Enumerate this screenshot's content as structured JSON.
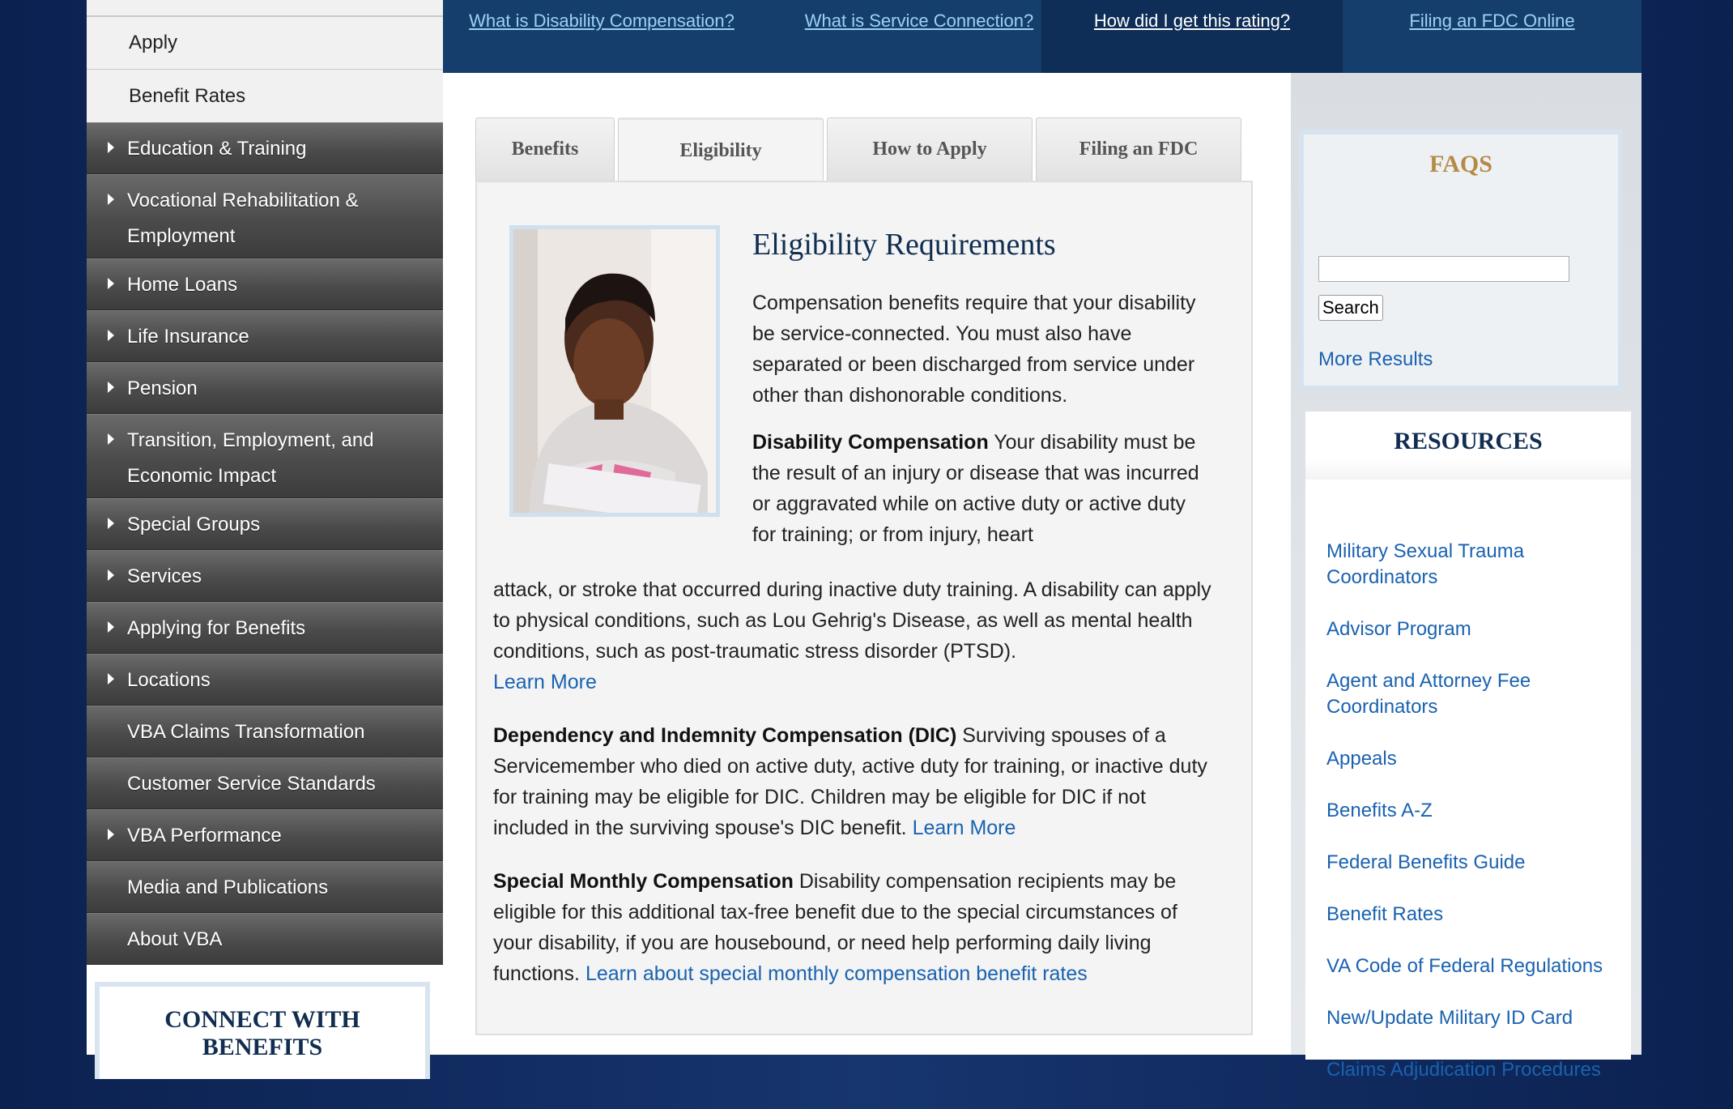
{
  "sidebar": {
    "light_items": [
      "Apply",
      "Benefit Rates"
    ],
    "dark_items": [
      {
        "label": "Education & Training",
        "arrow": true
      },
      {
        "label": "Vocational Rehabilitation & Employment",
        "arrow": true
      },
      {
        "label": "Home Loans",
        "arrow": true
      },
      {
        "label": "Life Insurance",
        "arrow": true
      },
      {
        "label": "Pension",
        "arrow": true
      },
      {
        "label": "Transition, Employment, and Economic Impact",
        "arrow": true
      },
      {
        "label": "Special Groups",
        "arrow": true
      },
      {
        "label": "Services",
        "arrow": true
      },
      {
        "label": "Applying for Benefits",
        "arrow": true
      },
      {
        "label": "Locations",
        "arrow": true
      },
      {
        "label": "VBA Claims Transformation",
        "arrow": false
      },
      {
        "label": "Customer Service Standards",
        "arrow": false
      },
      {
        "label": "VBA Performance",
        "arrow": true
      },
      {
        "label": "Media and Publications",
        "arrow": false
      },
      {
        "label": "About VBA",
        "arrow": false
      }
    ],
    "connect_title": "CONNECT WITH BENEFITS"
  },
  "topnav": {
    "links": [
      {
        "label": "What is Disability Compensation?",
        "active": false
      },
      {
        "label": "What is Service Connection?",
        "active": false
      },
      {
        "label": "How did I get this rating?",
        "active": true
      },
      {
        "label": "Filing an FDC Online",
        "active": false
      }
    ]
  },
  "tabs": [
    {
      "label": "Benefits",
      "active": false
    },
    {
      "label": "Eligibility",
      "active": true
    },
    {
      "label": "How to Apply",
      "active": false
    },
    {
      "label": "Filing an FDC",
      "active": false
    }
  ],
  "content": {
    "title": "Eligibility Requirements",
    "intro": "Compensation benefits require that your disability be service-connected. You must also have separated or been discharged from service under other than dishonorable conditions.",
    "disability": {
      "heading": "Disability Compensation",
      "text_top": " Your disability must be the result of an injury or disease that was incurred or aggravated while on active duty or active duty for training; or from injury, heart",
      "text_bottom": "attack, or stroke that occurred during inactive duty training. A disability can apply to physical conditions, such as Lou Gehrig's Disease, as well as mental health conditions, such as post-traumatic stress disorder (PTSD).",
      "link": "Learn More"
    },
    "dic": {
      "heading": "Dependency and Indemnity Compensation (DIC)",
      "text": " Surviving spouses of a Servicemember who died on active duty, active duty for training, or inactive duty for training may be eligible for DIC. Children may be eligible for DIC if not included in the surviving spouse's DIC benefit. ",
      "link": "Learn More"
    },
    "smc": {
      "heading": "Special Monthly Compensation",
      "text": " Disability compensation recipients may be eligible for this additional tax-free benefit due to the special circumstances of your disability, if you are housebound, or need help performing daily living functions. ",
      "link": "Learn about special monthly compensation benefit rates"
    }
  },
  "faq": {
    "title": "FAQS",
    "input_value": "",
    "search_label": "Search",
    "more_label": "More Results"
  },
  "resources": {
    "title": "RESOURCES",
    "links": [
      "Military Sexual Trauma Coordinators",
      "Advisor Program",
      "Agent and Attorney Fee Coordinators",
      "Appeals",
      "Benefits A-Z",
      "Federal Benefits Guide",
      "Benefit Rates",
      "VA Code of Federal Regulations",
      "New/Update Military ID Card",
      "Claims Adjudication Procedures"
    ]
  }
}
